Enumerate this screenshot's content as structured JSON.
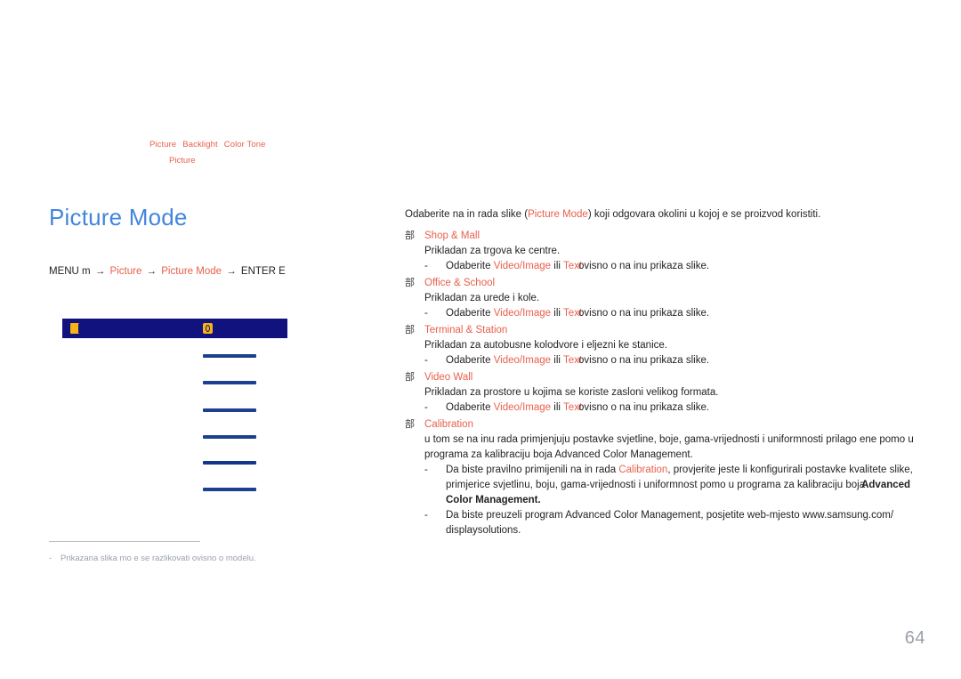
{
  "header": {
    "breadcrumbs": [
      "Picture",
      "Backlight",
      "Color Tone"
    ],
    "sub_breadcrumb": "Picture"
  },
  "left": {
    "title": "Picture Mode",
    "menu_path": {
      "menu_label": "MENU m",
      "arrow": "→",
      "step1": "Picture",
      "step2": "Picture Mode",
      "enter_label": "ENTER E"
    },
    "osd": {
      "icon1": "picture-icon",
      "icon2": "display-icon",
      "row_count": 6
    },
    "footnote": {
      "dash": "-",
      "text": "Prikazana slika mo e se razlikovati ovisno o modelu."
    }
  },
  "right": {
    "intro_before": "Odaberite na in rada slike (",
    "intro_highlight": "Picture Mode",
    "intro_after": ") koji odgovara okolini u kojoj  e se proizvod koristiti.",
    "bullet_glyph": "部",
    "sub_dash": "-",
    "modes": [
      {
        "name": "Shop & Mall",
        "desc": "Prikladan za trgova ke centre.",
        "sub": {
          "before": "Odaberite ",
          "hl1": "Video/Image",
          "mid": " ili ",
          "hl2": "Text",
          "after": "ovisno o na inu prikaza slike."
        }
      },
      {
        "name": "Office & School",
        "desc": "Prikladan za urede i  kole.",
        "sub": {
          "before": "Odaberite ",
          "hl1": "Video/Image",
          "mid": " ili ",
          "hl2": "Text",
          "after": "ovisno o na inu prikaza slike."
        }
      },
      {
        "name": "Terminal & Station",
        "desc": "Prikladan za autobusne kolodvore i  eljezni ke stanice.",
        "sub": {
          "before": "Odaberite ",
          "hl1": "Video/Image",
          "mid": " ili ",
          "hl2": "Text",
          "after": "ovisno o na inu prikaza slike."
        }
      },
      {
        "name": "Video Wall",
        "desc": "Prikladan za prostore u kojima se koriste zasloni velikog formata.",
        "sub": {
          "before": "Odaberite ",
          "hl1": "Video/Image",
          "mid": " ili ",
          "hl2": "Text",
          "after": "ovisno o na inu prikaza slike."
        }
      }
    ],
    "calibration": {
      "name": "Calibration",
      "desc_line1": "u tom se na inu rada primjenjuju postavke svjetline, boje, gama-vrijednosti i uniformnosti prilago ene pomo u",
      "desc_line2": "programa za kalibraciju boja Advanced Color Management.",
      "sub1": {
        "before": "Da biste pravilno primijenili na in rada ",
        "hl": "Calibration",
        "after": ", provjerite jeste li konfigurirali postavke kvalitete slike, primjerice",
        "line2a": "svjetlinu, boju, gama-vrijednosti i uniformnost pomo u programa za kalibraciju boja",
        "line2b": "Advanced Color Management."
      },
      "sub2": {
        "line1": "Da biste preuzeli program Advanced Color Management, posjetite web-mjesto www.samsung.com/",
        "line2": "displaysolutions."
      }
    }
  },
  "page_number": "64",
  "colors": {
    "accent_orange": "#e8604c",
    "title_blue": "#4285dd",
    "osd_navy": "#12127e",
    "osd_bar_blue": "#1b3f91",
    "osd_icon_yellow": "#f5b315",
    "muted_gray": "#9aa0ab"
  }
}
